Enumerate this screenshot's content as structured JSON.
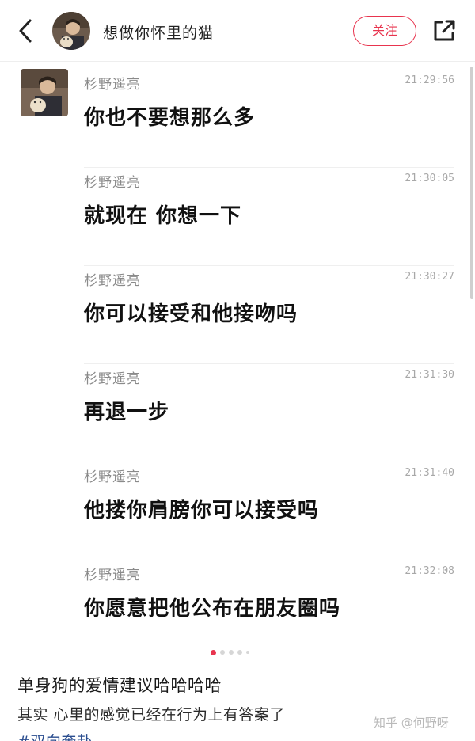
{
  "header": {
    "title": "想做你怀里的猫",
    "follow_label": "关注",
    "back_icon": "chevron-left-icon",
    "share_icon": "share-external-icon"
  },
  "messages": [
    {
      "sender": "杉野遥亮",
      "time": "21:29:56",
      "text": "你也不要想那么多"
    },
    {
      "sender": "杉野遥亮",
      "time": "21:30:05",
      "text": "就现在 你想一下"
    },
    {
      "sender": "杉野遥亮",
      "time": "21:30:27",
      "text": "你可以接受和他接吻吗"
    },
    {
      "sender": "杉野遥亮",
      "time": "21:31:30",
      "text": "再退一步"
    },
    {
      "sender": "杉野遥亮",
      "time": "21:31:40",
      "text": "他搂你肩膀你可以接受吗"
    },
    {
      "sender": "杉野遥亮",
      "time": "21:32:08",
      "text": "你愿意把他公布在朋友圈吗"
    }
  ],
  "carousel": {
    "count": 5,
    "active_index": 0
  },
  "post": {
    "title": "单身狗的爱情建议哈哈哈哈",
    "body": "其实 心里的感觉已经在行为上有答案了",
    "tags": "#双向奔赴"
  },
  "watermark": "知乎 @何野呀",
  "colors": {
    "accent": "#e8344e",
    "muted": "#8a8a8a",
    "divider": "#efefef"
  }
}
